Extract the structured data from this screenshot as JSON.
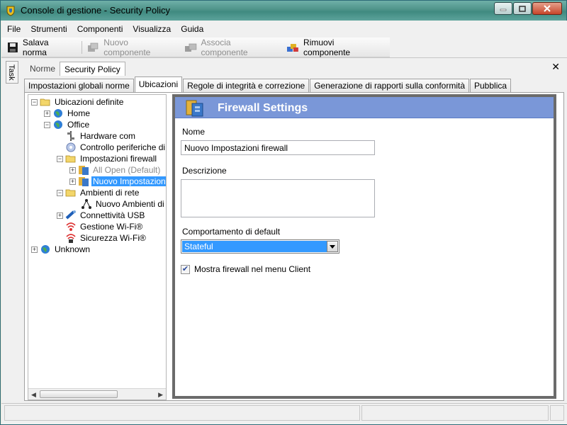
{
  "window": {
    "title": "Console di gestione  - Security Policy"
  },
  "menu": [
    "File",
    "Strumenti",
    "Componenti",
    "Visualizza",
    "Guida"
  ],
  "toolbar": {
    "save": "Salava norma",
    "new_component": "Nuovo componente",
    "associate_component": "Associa componente",
    "remove_component": "Rimuovi componente"
  },
  "task_label": "Task",
  "doc_tabs": [
    "Norme",
    "Security Policy"
  ],
  "tabs": [
    "Impostazioni globali norme",
    "Ubicazioni",
    "Regole di integrità e correzione",
    "Generazione di rapporti sulla conformità",
    "Pubblica"
  ],
  "tree": {
    "root": "Ubicazioni definite",
    "home": "Home",
    "office": "Office",
    "hardware": "Hardware com",
    "devices": "Controllo periferiche di",
    "firewall_settings": "Impostazioni firewall",
    "all_open": "All Open (Default)",
    "new_settings": "Nuovo Impostazioni",
    "network": "Ambienti di rete",
    "new_network": "Nuovo Ambienti di r",
    "usb": "Connettività USB",
    "wifi_mgmt": "Gestione Wi-Fi®",
    "wifi_sec": "Sicurezza Wi-Fi®",
    "unknown": "Unknown"
  },
  "detail": {
    "header": "Firewall Settings",
    "name_label": "Nome",
    "name_value": "Nuovo Impostazioni firewall",
    "description_label": "Descrizione",
    "default_label": "Comportamento di default",
    "default_value": "Stateful",
    "checkbox_label": "Mostra firewall nel menu Client",
    "checkbox_checked": true
  },
  "colors": {
    "header": "#7a97d8",
    "selection": "#3399ff",
    "titlebar": "#4e9389"
  }
}
